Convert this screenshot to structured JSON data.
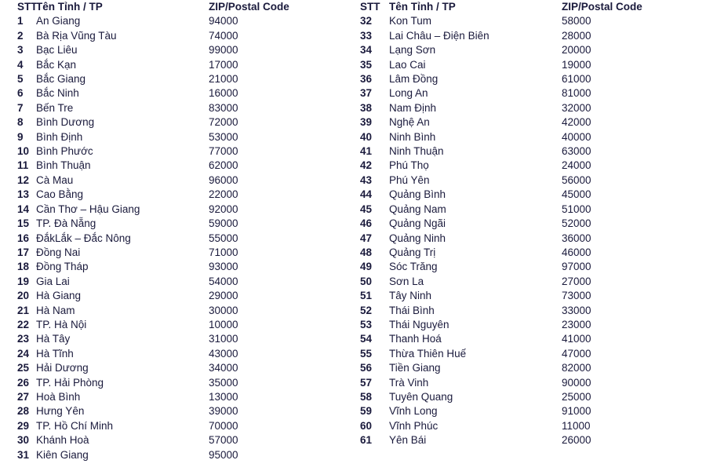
{
  "document": {
    "columns_count": 2,
    "text_color": "#1a1a3c",
    "background_color": "#ffffff"
  },
  "headers": {
    "stt": "STT",
    "name": "Tên Tỉnh / TP",
    "zip": "ZIP/Postal Code"
  },
  "left_column": {
    "header": {
      "stt": "STT",
      "name": "Tên Tỉnh / TP",
      "zip": "ZIP/Postal Code"
    },
    "rows": [
      {
        "stt": "1",
        "name": "An Giang",
        "zip": "94000"
      },
      {
        "stt": "2",
        "name": "Bà Rịa Vũng Tàu",
        "zip": "74000"
      },
      {
        "stt": "3",
        "name": "Bạc Liêu",
        "zip": "99000"
      },
      {
        "stt": "4",
        "name": "Bắc Kạn",
        "zip": "17000"
      },
      {
        "stt": "5",
        "name": "Bắc Giang",
        "zip": "21000"
      },
      {
        "stt": "6",
        "name": "Bắc Ninh",
        "zip": "16000"
      },
      {
        "stt": "7",
        "name": "Bến Tre",
        "zip": "83000"
      },
      {
        "stt": "8",
        "name": "Bình Dương",
        "zip": "72000"
      },
      {
        "stt": "9",
        "name": "Bình Định",
        "zip": "53000"
      },
      {
        "stt": "10",
        "name": "Bình Phước",
        "zip": "77000"
      },
      {
        "stt": "11",
        "name": "Bình Thuận",
        "zip": "62000"
      },
      {
        "stt": "12",
        "name": "Cà Mau",
        "zip": "96000"
      },
      {
        "stt": "13",
        "name": "Cao Bằng",
        "zip": "22000"
      },
      {
        "stt": "14",
        "name": "Cần Thơ – Hậu Giang",
        "zip": "92000"
      },
      {
        "stt": "15",
        "name": "TP. Đà Nẵng",
        "zip": "59000"
      },
      {
        "stt": "16",
        "name": "ĐắkLắk – Đắc Nông",
        "zip": "55000"
      },
      {
        "stt": "17",
        "name": "Đồng Nai",
        "zip": "71000"
      },
      {
        "stt": "18",
        "name": "Đồng Tháp",
        "zip": "93000"
      },
      {
        "stt": "19",
        "name": "Gia Lai",
        "zip": "54000"
      },
      {
        "stt": "20",
        "name": "Hà Giang",
        "zip": "29000"
      },
      {
        "stt": "21",
        "name": "Hà Nam",
        "zip": "30000"
      },
      {
        "stt": "22",
        "name": "TP. Hà Nội",
        "zip": "10000"
      },
      {
        "stt": "23",
        "name": "Hà Tây",
        "zip": "31000"
      },
      {
        "stt": "24",
        "name": "Hà Tĩnh",
        "zip": "43000"
      },
      {
        "stt": "25",
        "name": "Hải Dương",
        "zip": "34000"
      },
      {
        "stt": "26",
        "name": "TP. Hải Phòng",
        "zip": "35000"
      },
      {
        "stt": "27",
        "name": "Hoà Bình",
        "zip": "13000"
      },
      {
        "stt": "28",
        "name": "Hưng Yên",
        "zip": "39000"
      },
      {
        "stt": "29",
        "name": "TP. Hồ Chí Minh",
        "zip": "70000"
      },
      {
        "stt": "30",
        "name": "Khánh Hoà",
        "zip": "57000"
      },
      {
        "stt": "31",
        "name": "Kiên Giang",
        "zip": "95000"
      }
    ]
  },
  "right_column": {
    "header": {
      "stt": "STT",
      "name": "Tên Tỉnh / TP",
      "zip": "ZIP/Postal Code"
    },
    "rows": [
      {
        "stt": "32",
        "name": "Kon Tum",
        "zip": "58000"
      },
      {
        "stt": "33",
        "name": "Lai Châu – Điện Biên",
        "zip": "28000"
      },
      {
        "stt": "34",
        "name": "Lạng Sơn",
        "zip": "20000"
      },
      {
        "stt": "35",
        "name": "Lao Cai",
        "zip": "19000"
      },
      {
        "stt": "36",
        "name": "Lâm Đồng",
        "zip": "61000"
      },
      {
        "stt": "37",
        "name": "Long An",
        "zip": "81000"
      },
      {
        "stt": "38",
        "name": "Nam Định",
        "zip": "32000"
      },
      {
        "stt": "39",
        "name": "Nghệ An",
        "zip": "42000"
      },
      {
        "stt": "40",
        "name": "Ninh Bình",
        "zip": "40000"
      },
      {
        "stt": "41",
        "name": "Ninh Thuận",
        "zip": "63000"
      },
      {
        "stt": "42",
        "name": "Phú Thọ",
        "zip": "24000"
      },
      {
        "stt": "43",
        "name": "Phú Yên",
        "zip": "56000"
      },
      {
        "stt": "44",
        "name": "Quảng Bình",
        "zip": "45000"
      },
      {
        "stt": "45",
        "name": "Quảng Nam",
        "zip": "51000"
      },
      {
        "stt": "46",
        "name": "Quảng Ngãi",
        "zip": "52000"
      },
      {
        "stt": "47",
        "name": "Quảng Ninh",
        "zip": "36000"
      },
      {
        "stt": "48",
        "name": "Quảng Trị",
        "zip": "46000"
      },
      {
        "stt": "49",
        "name": "Sóc Trăng",
        "zip": "97000"
      },
      {
        "stt": "50",
        "name": "Sơn La",
        "zip": "27000"
      },
      {
        "stt": "51",
        "name": "Tây Ninh",
        "zip": "73000"
      },
      {
        "stt": "52",
        "name": "Thái Bình",
        "zip": "33000"
      },
      {
        "stt": "53",
        "name": "Thái Nguyên",
        "zip": "23000"
      },
      {
        "stt": "54",
        "name": "Thanh Hoá",
        "zip": "41000"
      },
      {
        "stt": "55",
        "name": "Thừa Thiên Huế",
        "zip": "47000"
      },
      {
        "stt": "56",
        "name": "Tiền Giang",
        "zip": "82000"
      },
      {
        "stt": "57",
        "name": "Trà Vinh",
        "zip": "90000"
      },
      {
        "stt": "58",
        "name": "Tuyên Quang",
        "zip": "25000"
      },
      {
        "stt": "59",
        "name": "Vĩnh Long",
        "zip": "91000"
      },
      {
        "stt": "60",
        "name": "Vĩnh Phúc",
        "zip": "11000"
      },
      {
        "stt": "61",
        "name": "Yên Bái",
        "zip": "26000"
      }
    ]
  }
}
